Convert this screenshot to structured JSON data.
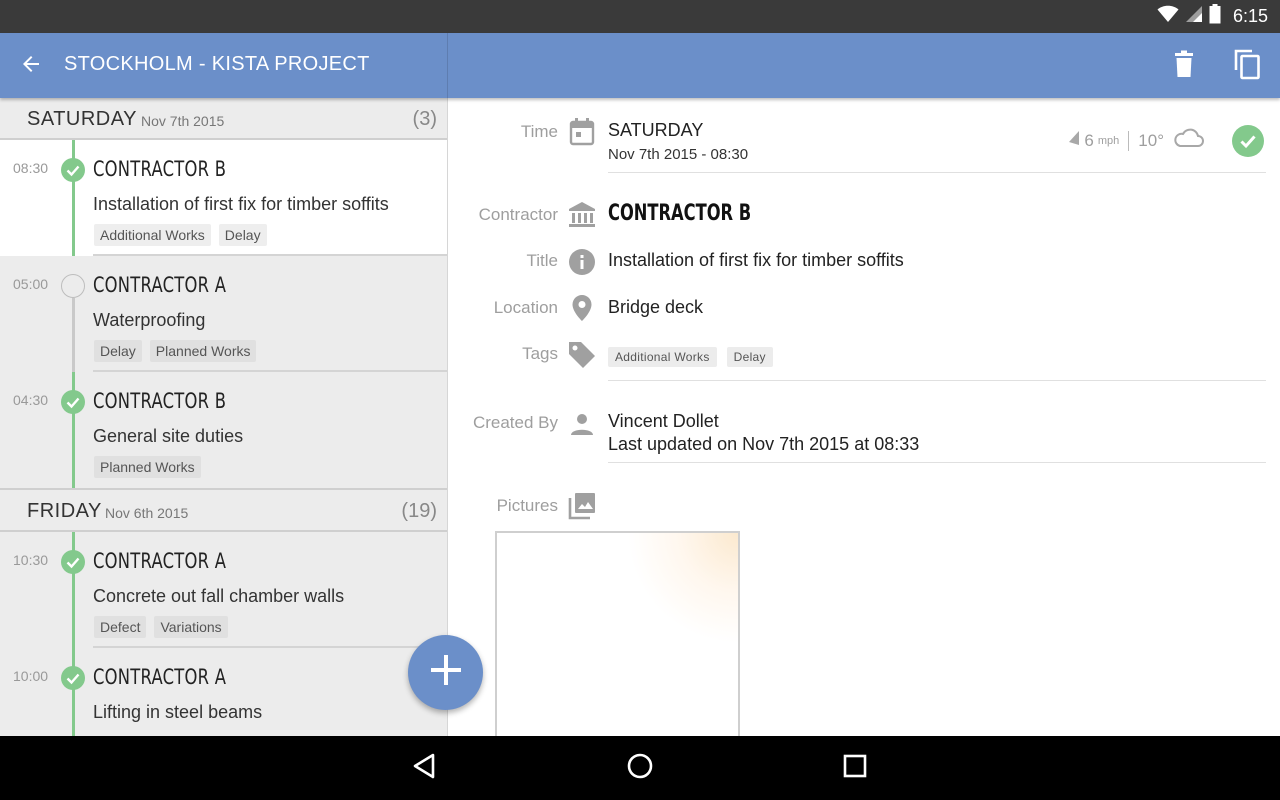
{
  "status_bar": {
    "time": "6:15"
  },
  "app_bar": {
    "title": "STOCKHOLM - KISTA PROJECT",
    "color": "#6b8fc9",
    "back_icon": "arrow-back-icon",
    "delete_icon": "trash-icon",
    "copy_icon": "copy-icon"
  },
  "days": [
    {
      "name": "SATURDAY",
      "date": "Nov 7th 2015",
      "count": "(3)",
      "entries": [
        {
          "time": "08:30",
          "contractor": "CONTRACTOR B",
          "title": "Installation of first fix for timber soffits",
          "tags": [
            "Additional Works",
            "Delay"
          ],
          "status": "done",
          "selected": true
        },
        {
          "time": "05:00",
          "contractor": "CONTRACTOR A",
          "title": "Waterproofing",
          "tags": [
            "Delay",
            "Planned Works"
          ],
          "status": "open",
          "selected": false
        },
        {
          "time": "04:30",
          "contractor": "CONTRACTOR B",
          "title": "General site duties",
          "tags": [
            "Planned Works"
          ],
          "status": "done",
          "selected": false
        }
      ]
    },
    {
      "name": "FRIDAY",
      "date": "Nov 6th 2015",
      "count": "(19)",
      "entries": [
        {
          "time": "10:30",
          "contractor": "CONTRACTOR A",
          "title": "Concrete out fall chamber walls",
          "tags": [
            "Defect",
            "Variations"
          ],
          "status": "done",
          "selected": false
        },
        {
          "time": "10:00",
          "contractor": "CONTRACTOR A",
          "title": "Lifting in steel beams",
          "tags": [],
          "status": "done",
          "selected": false
        }
      ]
    }
  ],
  "detail": {
    "labels": {
      "time": "Time",
      "contractor": "Contractor",
      "title": "Title",
      "location": "Location",
      "tags": "Tags",
      "created_by": "Created By",
      "pictures": "Pictures"
    },
    "day": "SATURDAY",
    "datetime": "Nov 7th 2015 - 08:30",
    "weather": {
      "wind": "6",
      "wind_unit": "mph",
      "temp": "10°",
      "icon": "cloud-icon"
    },
    "contractor": "CONTRACTOR B",
    "title": "Installation of first fix for timber soffits",
    "location": "Bridge deck",
    "tags": [
      "Additional Works",
      "Delay"
    ],
    "created_by": "Vincent Dollet",
    "last_updated": "Last updated on Nov 7th 2015 at 08:33",
    "status": "done"
  },
  "colors": {
    "accent": "#6b8fc9",
    "done": "#83c98c"
  }
}
